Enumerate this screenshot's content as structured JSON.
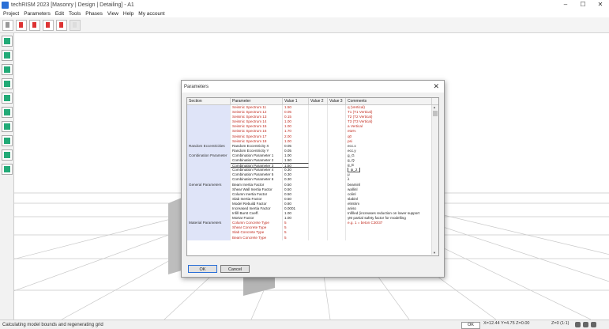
{
  "window": {
    "title": "techRISM 2023 [Masonry | Design | Detailing] - A1"
  },
  "menu": [
    "Project",
    "Parameters",
    "Edit",
    "Tools",
    "Phases",
    "View",
    "Help",
    "My account"
  ],
  "window_controls": [
    "–",
    "☐",
    "✕"
  ],
  "dialog": {
    "title": "Parameters",
    "close": "✕",
    "columns": [
      "Section",
      "Parameter",
      "Value 1",
      "Value 2",
      "Value 3",
      "Comments"
    ],
    "rows": [
      {
        "section": "",
        "param": "Seismic Spectrum 11",
        "v1": "1.50",
        "comment": "q (Vertical)",
        "red": true
      },
      {
        "section": "",
        "param": "Seismic Spectrum 12",
        "v1": "0.05",
        "comment": "T1 (T1 Vertical)",
        "red": true
      },
      {
        "section": "",
        "param": "Seismic Spectrum 13",
        "v1": "0.15",
        "comment": "T2 (T2 Vertical)",
        "red": true
      },
      {
        "section": "",
        "param": "Seismic Spectrum 14",
        "v1": "1.00",
        "comment": "T3 (T3 Vertical)",
        "red": true
      },
      {
        "section": "",
        "param": "Seismic Spectrum 15",
        "v1": "1.00",
        "comment": "a Vertical",
        "red": true
      },
      {
        "section": "",
        "param": "Seismic Spectrum 16",
        "v1": "1.70",
        "comment": "eta%",
        "red": true
      },
      {
        "section": "",
        "param": "Seismic Spectrum 17",
        "v1": "2.00",
        "comment": "q0",
        "red": true
      },
      {
        "section": "",
        "param": "Seismic Spectrum 18",
        "v1": "1.00",
        "comment": "psi",
        "red": true
      },
      {
        "section": "Random Eccentricities",
        "param": "Random Eccentricity X",
        "v1": "0.05",
        "comment": "ecc.x",
        "red": false
      },
      {
        "section": "",
        "param": "Random Eccentricity Y",
        "v1": "0.05",
        "comment": "ecc.y",
        "red": false
      },
      {
        "section": "Combination Parameter",
        "param": "Combination Parameter 1",
        "v1": "1.00",
        "comment": "g_G",
        "red": false
      },
      {
        "section": "",
        "param": "Combination Parameter 2",
        "v1": "1.50",
        "comment": "g_Q",
        "red": false
      },
      {
        "section": "",
        "param": "Combination Parameter 3",
        "v1": "1.50",
        "comment": "g_E",
        "red": false,
        "sel": true
      },
      {
        "section": "",
        "param": "Combination Parameter 4",
        "v1": "0.30",
        "comment": "ψ_2",
        "red": false,
        "edit": true
      },
      {
        "section": "",
        "param": "Combination Parameter 5",
        "v1": "0.30",
        "comment": "μ",
        "red": false
      },
      {
        "section": "",
        "param": "Combination Parameter 6",
        "v1": "0.30",
        "comment": "λ",
        "red": false
      },
      {
        "section": "General Parameters",
        "param": "Beam Inertia Factor",
        "v1": "0.50",
        "comment": "beaminl",
        "red": false
      },
      {
        "section": "",
        "param": "Shear Wall Inertia Factor",
        "v1": "0.50",
        "comment": "wallinl",
        "red": false
      },
      {
        "section": "",
        "param": "Column Inertia Factor",
        "v1": "0.50",
        "comment": "colinl",
        "red": false
      },
      {
        "section": "",
        "param": "Slab Inertia Factor",
        "v1": "0.50",
        "comment": "slabinl",
        "red": false
      },
      {
        "section": "",
        "param": "Model Rebuild Factor",
        "v1": "0.80",
        "comment": "elmtrim",
        "red": false
      },
      {
        "section": "",
        "param": "Increased Inertia Factor",
        "v1": "0.0001",
        "comment": "aniso",
        "red": false
      },
      {
        "section": "",
        "param": "Infill Burst Coeff.",
        "v1": "1.00",
        "comment": "Infilled (increases reduction on lower support",
        "red": false
      },
      {
        "section": "",
        "param": "Mortar Factor",
        "v1": "1.00",
        "comment": "γM partial safety factor for modelling",
        "red": false
      },
      {
        "section": "Material Parameters",
        "param": "Column Concrete Type",
        "v1": "5",
        "comment": "e.g. 1 = beton C30/37",
        "red": true
      },
      {
        "section": "",
        "param": "Shear Concrete Type",
        "v1": "5",
        "comment": "",
        "red": true
      },
      {
        "section": "",
        "param": "Slab Concrete Type",
        "v1": "5",
        "comment": "",
        "red": true
      },
      {
        "section": "",
        "param": "Beam Concrete Type",
        "v1": "5",
        "comment": "",
        "red": true
      }
    ],
    "buttons": {
      "ok": "OK",
      "cancel": "Cancel"
    }
  },
  "status": {
    "message": "Calculating model bounds and regenerating grid",
    "box": "OK",
    "coords": "X=12.44 Y=4.75 Z=0.00",
    "zoom": "Z=0 (1:1)"
  }
}
